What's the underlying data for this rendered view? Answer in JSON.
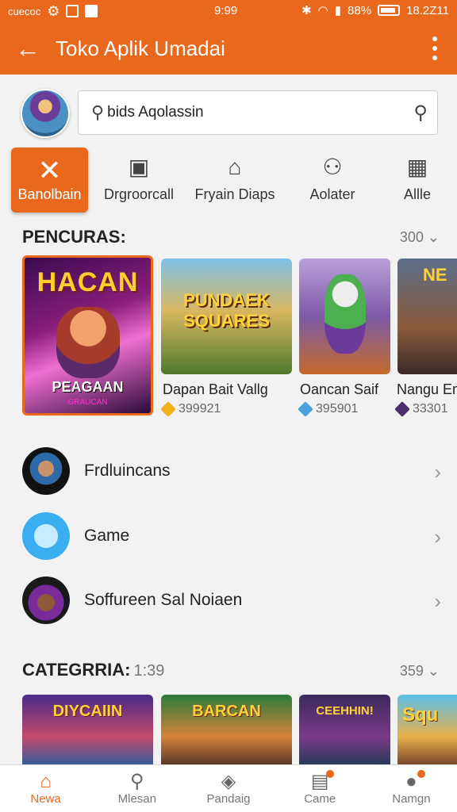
{
  "status": {
    "carrier": "cuecoc",
    "time": "9:99",
    "battery": "88%",
    "clock_right": "18.2Z11"
  },
  "appbar": {
    "title": "Toko Aplik Umadai"
  },
  "search": {
    "value": "bids Aqolassin"
  },
  "categories": [
    {
      "label": "Banolbain",
      "icon": "close-icon",
      "active": true
    },
    {
      "label": "Drgroorcall",
      "icon": "briefcase-icon",
      "active": false
    },
    {
      "label": "Fryain Diaps",
      "icon": "package-icon",
      "active": false
    },
    {
      "label": "Aolater",
      "icon": "person-icon",
      "active": false
    },
    {
      "label": "Allle",
      "icon": "grid-icon",
      "active": false
    }
  ],
  "section1": {
    "title": "PENCURAS:",
    "count": "300"
  },
  "featured": {
    "title_top": "HACAN",
    "title_bottom": "PEAGAAN",
    "subtitle": "GRAUCAN"
  },
  "apps": [
    {
      "title": "Dapan Bait Vallg",
      "rating": "399921",
      "art": "PUNDAEK SQUARES"
    },
    {
      "title": "Oancan Saif",
      "rating": "395901",
      "art": ""
    },
    {
      "title": "Nangu Em",
      "rating": "33301",
      "art": "NE"
    }
  ],
  "list": [
    {
      "label": "Frdluincans"
    },
    {
      "label": "Game"
    },
    {
      "label": "Soffureen Sal Noiaen"
    }
  ],
  "section2": {
    "title": "CATEGRRIA:",
    "sub": "1:39",
    "count": "359"
  },
  "category_tiles": [
    "DIYCAIIN",
    "BARCAN",
    "CEEHHIN!",
    "Squ"
  ],
  "nav": [
    {
      "label": "Newa",
      "icon": "home-icon",
      "active": true
    },
    {
      "label": "Mlesan",
      "icon": "search-icon",
      "active": false
    },
    {
      "label": "Pandaig",
      "icon": "play-icon",
      "active": false
    },
    {
      "label": "Came",
      "icon": "list-icon",
      "active": false
    },
    {
      "label": "Namgn",
      "icon": "profile-icon",
      "active": false
    }
  ],
  "colors": {
    "accent": "#e9681c"
  }
}
